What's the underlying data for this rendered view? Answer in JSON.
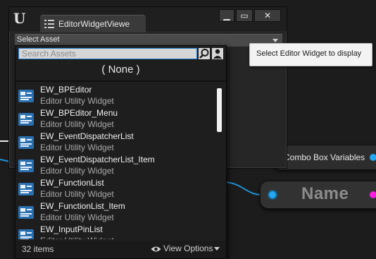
{
  "window": {
    "tab_label": "EditorWidgetViewe",
    "minimize_label": "▁",
    "maximize_label": "▭",
    "close_label": "✕"
  },
  "select_asset": {
    "label": "Select Asset"
  },
  "tooltip": {
    "text": "Select Editor Widget to display"
  },
  "dropdown": {
    "search_placeholder": "Search Assets",
    "none_label": "( None )",
    "items": [
      {
        "name": "EW_BPEditor",
        "type": "Editor Utility Widget"
      },
      {
        "name": "EW_BPEditor_Menu",
        "type": "Editor Utility Widget"
      },
      {
        "name": "EW_EventDispatcherList",
        "type": "Editor Utility Widget"
      },
      {
        "name": "EW_EventDispatcherList_Item",
        "type": "Editor Utility Widget"
      },
      {
        "name": "EW_FunctionList",
        "type": "Editor Utility Widget"
      },
      {
        "name": "EW_FunctionList_Item",
        "type": "Editor Utility Widget"
      },
      {
        "name": "EW_InputPinList",
        "type": "Editor Utility Widget"
      }
    ],
    "items_count": "32 items",
    "view_options_label": "View Options"
  },
  "graph": {
    "combo_node_label": "Combo Box Variables",
    "name_node_label": "Name"
  },
  "colors": {
    "pin_blue": "#22a7f0",
    "pin_magenta": "#ff1de0",
    "selection_blue": "#2a7fd4"
  }
}
